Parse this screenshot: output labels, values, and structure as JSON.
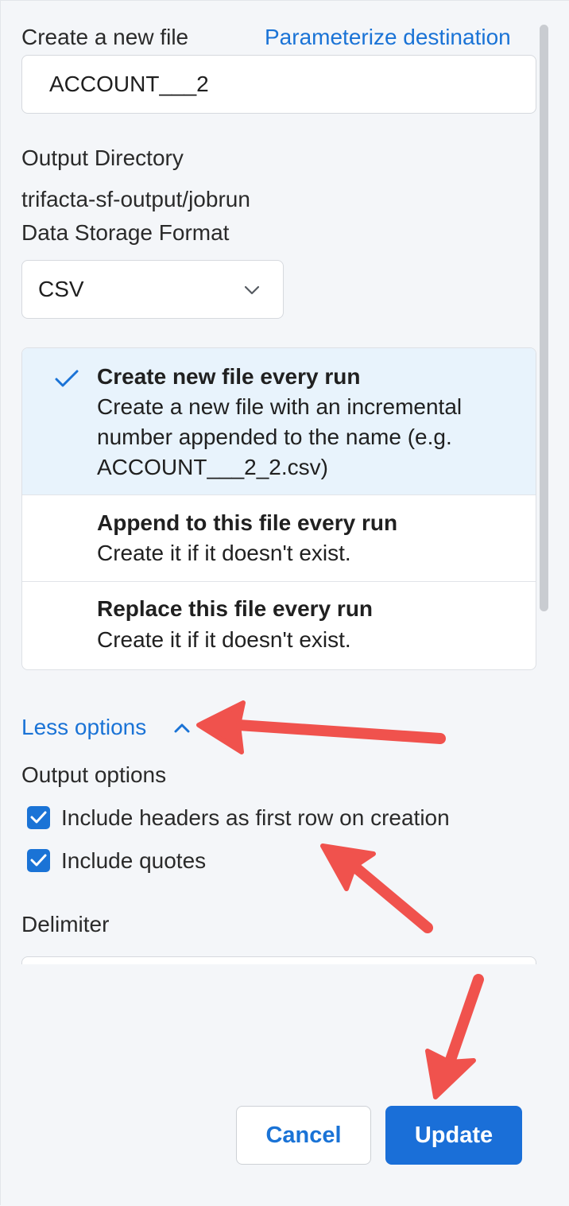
{
  "destination": {
    "create_label": "Create a new file",
    "parameterize_link": "Parameterize destination",
    "filename_value": "ACCOUNT___2"
  },
  "output_directory": {
    "label": "Output Directory",
    "path": "trifacta-sf-output/jobrun"
  },
  "storage_format": {
    "label": "Data Storage Format",
    "selected": "CSV"
  },
  "write_actions": [
    {
      "title": "Create new file every run",
      "description": "Create a new file with an incremental number appended to the name (e.g. ACCOUNT___2_2.csv)",
      "selected": true
    },
    {
      "title": "Append to this file every run",
      "description": "Create it if it doesn't exist.",
      "selected": false
    },
    {
      "title": "Replace this file every run",
      "description": "Create it if it doesn't exist.",
      "selected": false
    }
  ],
  "options_toggle": {
    "label": "Less options",
    "icon": "chevron-up-icon"
  },
  "output_options": {
    "label": "Output options",
    "checkboxes": [
      {
        "label": "Include headers as first row on creation",
        "checked": true
      },
      {
        "label": "Include quotes",
        "checked": true
      }
    ]
  },
  "delimiter": {
    "label": "Delimiter"
  },
  "footer": {
    "cancel_label": "Cancel",
    "update_label": "Update"
  },
  "colors": {
    "accent": "#1a73d6",
    "selected_row": "#e8f3fc",
    "annotation_arrow": "#f0524d"
  }
}
